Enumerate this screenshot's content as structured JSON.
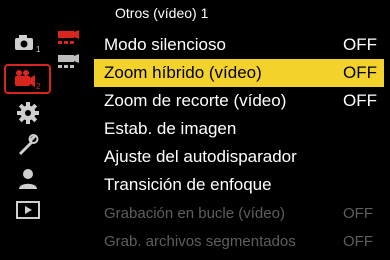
{
  "header": {
    "title": "Otros (vídeo) 1"
  },
  "sidebar": {
    "items": [
      {
        "icon": "photo-camera-icon",
        "sub": "1"
      },
      {
        "icon": "video-camera-icon",
        "sub": "2",
        "active": true
      },
      {
        "icon": "gear-icon"
      },
      {
        "icon": "wrench-icon"
      },
      {
        "icon": "person-icon"
      },
      {
        "icon": "playback-icon"
      }
    ]
  },
  "colors": {
    "accent": "#d8251d",
    "highlight": "#f2d22b",
    "disabled": "#5e5e5e"
  },
  "menu": {
    "items": [
      {
        "label": "Modo silencioso",
        "value": "OFF"
      },
      {
        "label": "Zoom híbrido (vídeo)",
        "value": "OFF",
        "selected": true
      },
      {
        "label": "Zoom de recorte (vídeo)",
        "value": "OFF"
      },
      {
        "label": "Estab. de imagen",
        "value": ""
      },
      {
        "label": "Ajuste del autodisparador",
        "value": ""
      },
      {
        "label": "Transición de enfoque",
        "value": ""
      },
      {
        "label": "Grabación en bucle (vídeo)",
        "value": "OFF",
        "disabled": true
      },
      {
        "label": "Grab. archivos segmentados",
        "value": "OFF",
        "disabled": true
      }
    ]
  }
}
